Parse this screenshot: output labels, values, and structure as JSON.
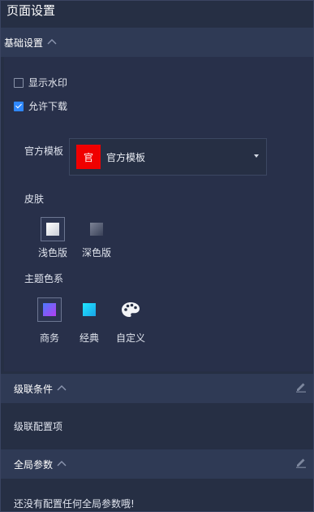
{
  "page": {
    "title": "页面设置"
  },
  "basic": {
    "title": "基础设置",
    "show_watermark": {
      "label": "显示水印",
      "checked": false
    },
    "allow_download": {
      "label": "允许下载",
      "checked": true
    },
    "template": {
      "label": "官方模板",
      "badge": "官",
      "value": "官方模板",
      "badge_color": "#f00000"
    },
    "skin": {
      "label": "皮肤",
      "options": [
        {
          "label": "浅色版",
          "selected": true
        },
        {
          "label": "深色版",
          "selected": false
        }
      ]
    },
    "theme": {
      "label": "主题色系",
      "options": [
        {
          "label": "商务",
          "selected": true,
          "icon": "gradient-purple-swatch"
        },
        {
          "label": "经典",
          "selected": false,
          "icon": "gradient-cyan-swatch"
        },
        {
          "label": "自定义",
          "selected": false,
          "icon": "palette-icon"
        }
      ]
    }
  },
  "cascade": {
    "title": "级联条件",
    "item": "级联配置项"
  },
  "global": {
    "title": "全局参数",
    "empty": "还没有配置任何全局参数哦!"
  },
  "colors": {
    "bg": "#262f44",
    "header": "#2f3a55",
    "accent": "#2f88ff"
  }
}
